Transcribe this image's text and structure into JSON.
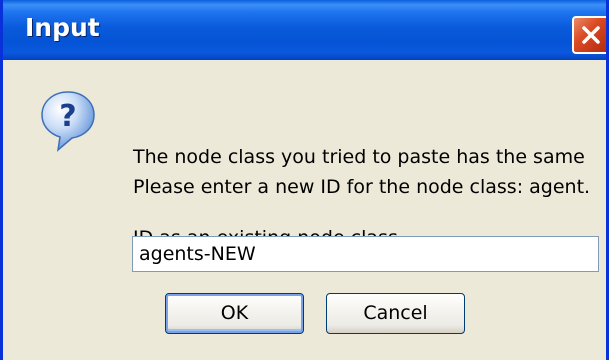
{
  "window": {
    "title": "Input",
    "close_icon": "close-x-icon"
  },
  "dialog": {
    "icon": "question-mark-icon",
    "message_lines": [
      "The node class you tried to paste has the same",
      "ID as an existing node class."
    ],
    "prompt": "Please enter a new ID for the node class: agent.",
    "input_value": "agents-NEW",
    "ok_label": "OK",
    "cancel_label": "Cancel"
  },
  "colors": {
    "titlebar": "#0553d6",
    "close_button": "#d64a22",
    "dialog_background": "#ece9d8",
    "input_border": "#7f9db9",
    "button_border": "#003c74"
  }
}
